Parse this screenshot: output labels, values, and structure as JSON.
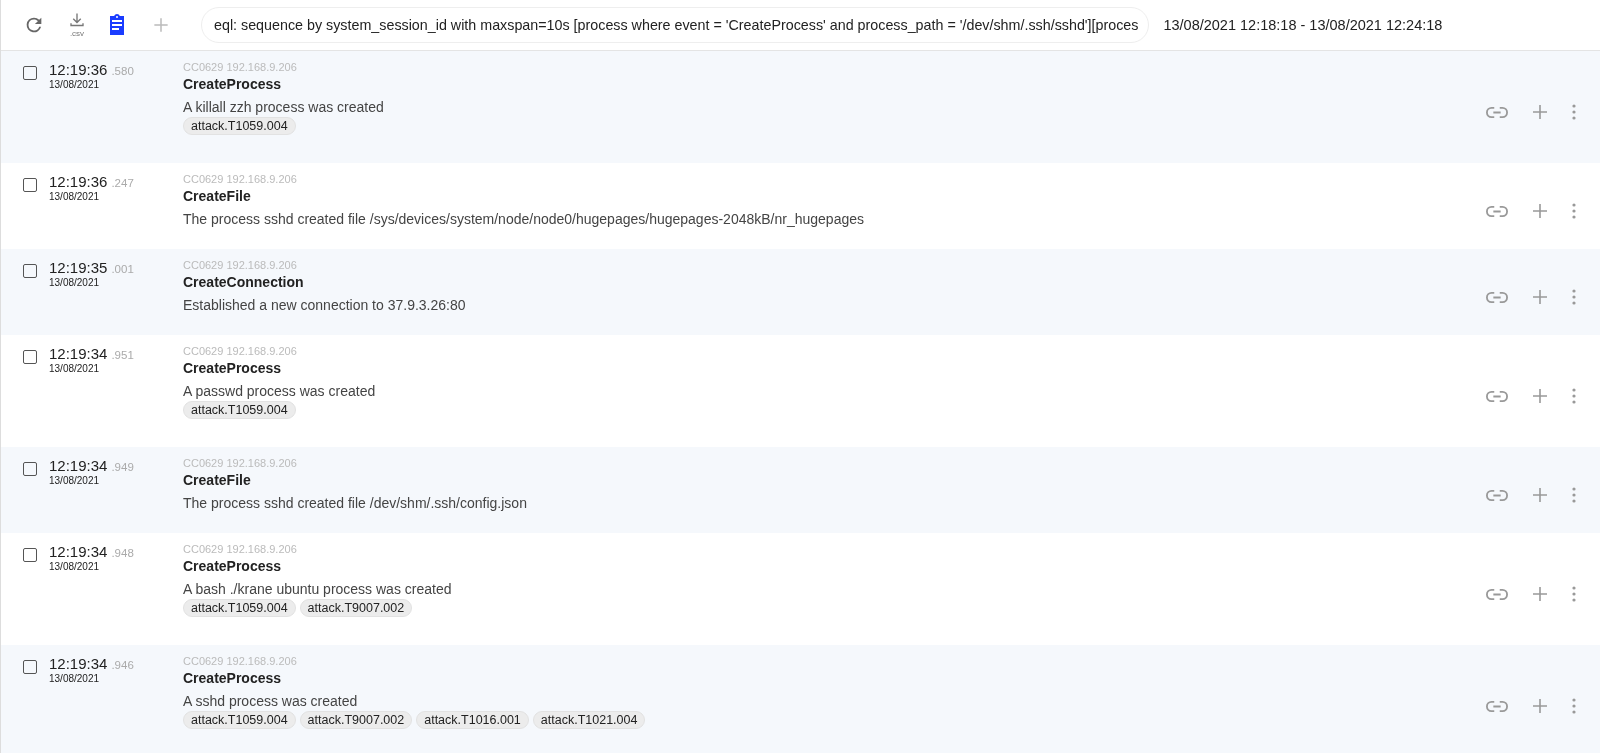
{
  "toolbar": {
    "csv_label": ".csv",
    "query": "eql: sequence by system_session_id with maxspan=10s [process where event = 'CreateProcess' and process_path = '/dev/shm/.ssh/sshd'][proces",
    "time_range": "13/08/2021 12:18:18 - 13/08/2021 12:24:18"
  },
  "events": [
    {
      "checked": false,
      "time": "12:19:36",
      "ms": ".580",
      "date": "13/08/2021",
      "source": "CC0629 192.168.9.206",
      "type": "CreateProcess",
      "description": "A killall zzh process was created",
      "tags": [
        "attack.T1059.004"
      ]
    },
    {
      "checked": false,
      "time": "12:19:36",
      "ms": ".247",
      "date": "13/08/2021",
      "source": "CC0629 192.168.9.206",
      "type": "CreateFile",
      "description": "The process sshd created file /sys/devices/system/node/node0/hugepages/hugepages-2048kB/nr_hugepages"
    },
    {
      "checked": false,
      "time": "12:19:35",
      "ms": ".001",
      "date": "13/08/2021",
      "source": "CC0629 192.168.9.206",
      "type": "CreateConnection",
      "description": "Established a new connection to 37.9.3.26:80"
    },
    {
      "checked": false,
      "time": "12:19:34",
      "ms": ".951",
      "date": "13/08/2021",
      "source": "CC0629 192.168.9.206",
      "type": "CreateProcess",
      "description": "A passwd process was created",
      "tags": [
        "attack.T1059.004"
      ]
    },
    {
      "checked": false,
      "time": "12:19:34",
      "ms": ".949",
      "date": "13/08/2021",
      "source": "CC0629 192.168.9.206",
      "type": "CreateFile",
      "description": "The process sshd created file /dev/shm/.ssh/config.json"
    },
    {
      "checked": false,
      "time": "12:19:34",
      "ms": ".948",
      "date": "13/08/2021",
      "source": "CC0629 192.168.9.206",
      "type": "CreateProcess",
      "description": "A bash ./krane ubuntu process was created",
      "tags": [
        "attack.T1059.004",
        "attack.T9007.002"
      ]
    },
    {
      "checked": false,
      "time": "12:19:34",
      "ms": ".946",
      "date": "13/08/2021",
      "source": "CC0629 192.168.9.206",
      "type": "CreateProcess",
      "description": "A sshd process was created",
      "tags": [
        "attack.T1059.004",
        "attack.T9007.002",
        "attack.T1016.001",
        "attack.T1021.004"
      ]
    }
  ]
}
